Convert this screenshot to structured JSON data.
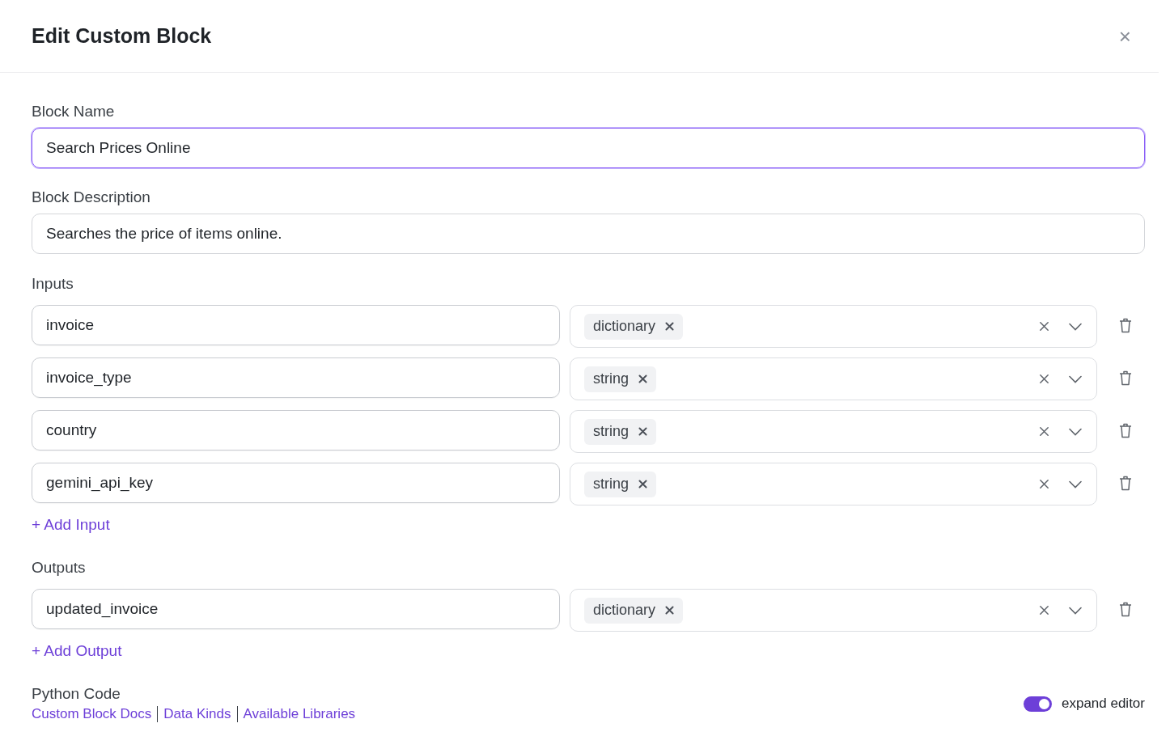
{
  "dialog": {
    "title": "Edit Custom Block",
    "close": "×"
  },
  "block_name": {
    "label": "Block Name",
    "value": "Search Prices Online",
    "focused": true
  },
  "block_description": {
    "label": "Block Description",
    "value": "Searches the price of items online.",
    "focused": false
  },
  "inputs": {
    "label": "Inputs",
    "add_label": "+ Add Input",
    "rows": [
      {
        "name": "invoice",
        "type": "dictionary"
      },
      {
        "name": "invoice_type",
        "type": "string"
      },
      {
        "name": "country",
        "type": "string"
      },
      {
        "name": "gemini_api_key",
        "type": "string"
      }
    ]
  },
  "outputs": {
    "label": "Outputs",
    "add_label": "+ Add Output",
    "rows": [
      {
        "name": "updated_invoice",
        "type": "dictionary"
      }
    ]
  },
  "python_code": {
    "label": "Python Code",
    "links": [
      "Custom Block Docs",
      "Data Kinds",
      "Available Libraries"
    ],
    "toggle": {
      "label": "expand editor",
      "on": true
    }
  }
}
